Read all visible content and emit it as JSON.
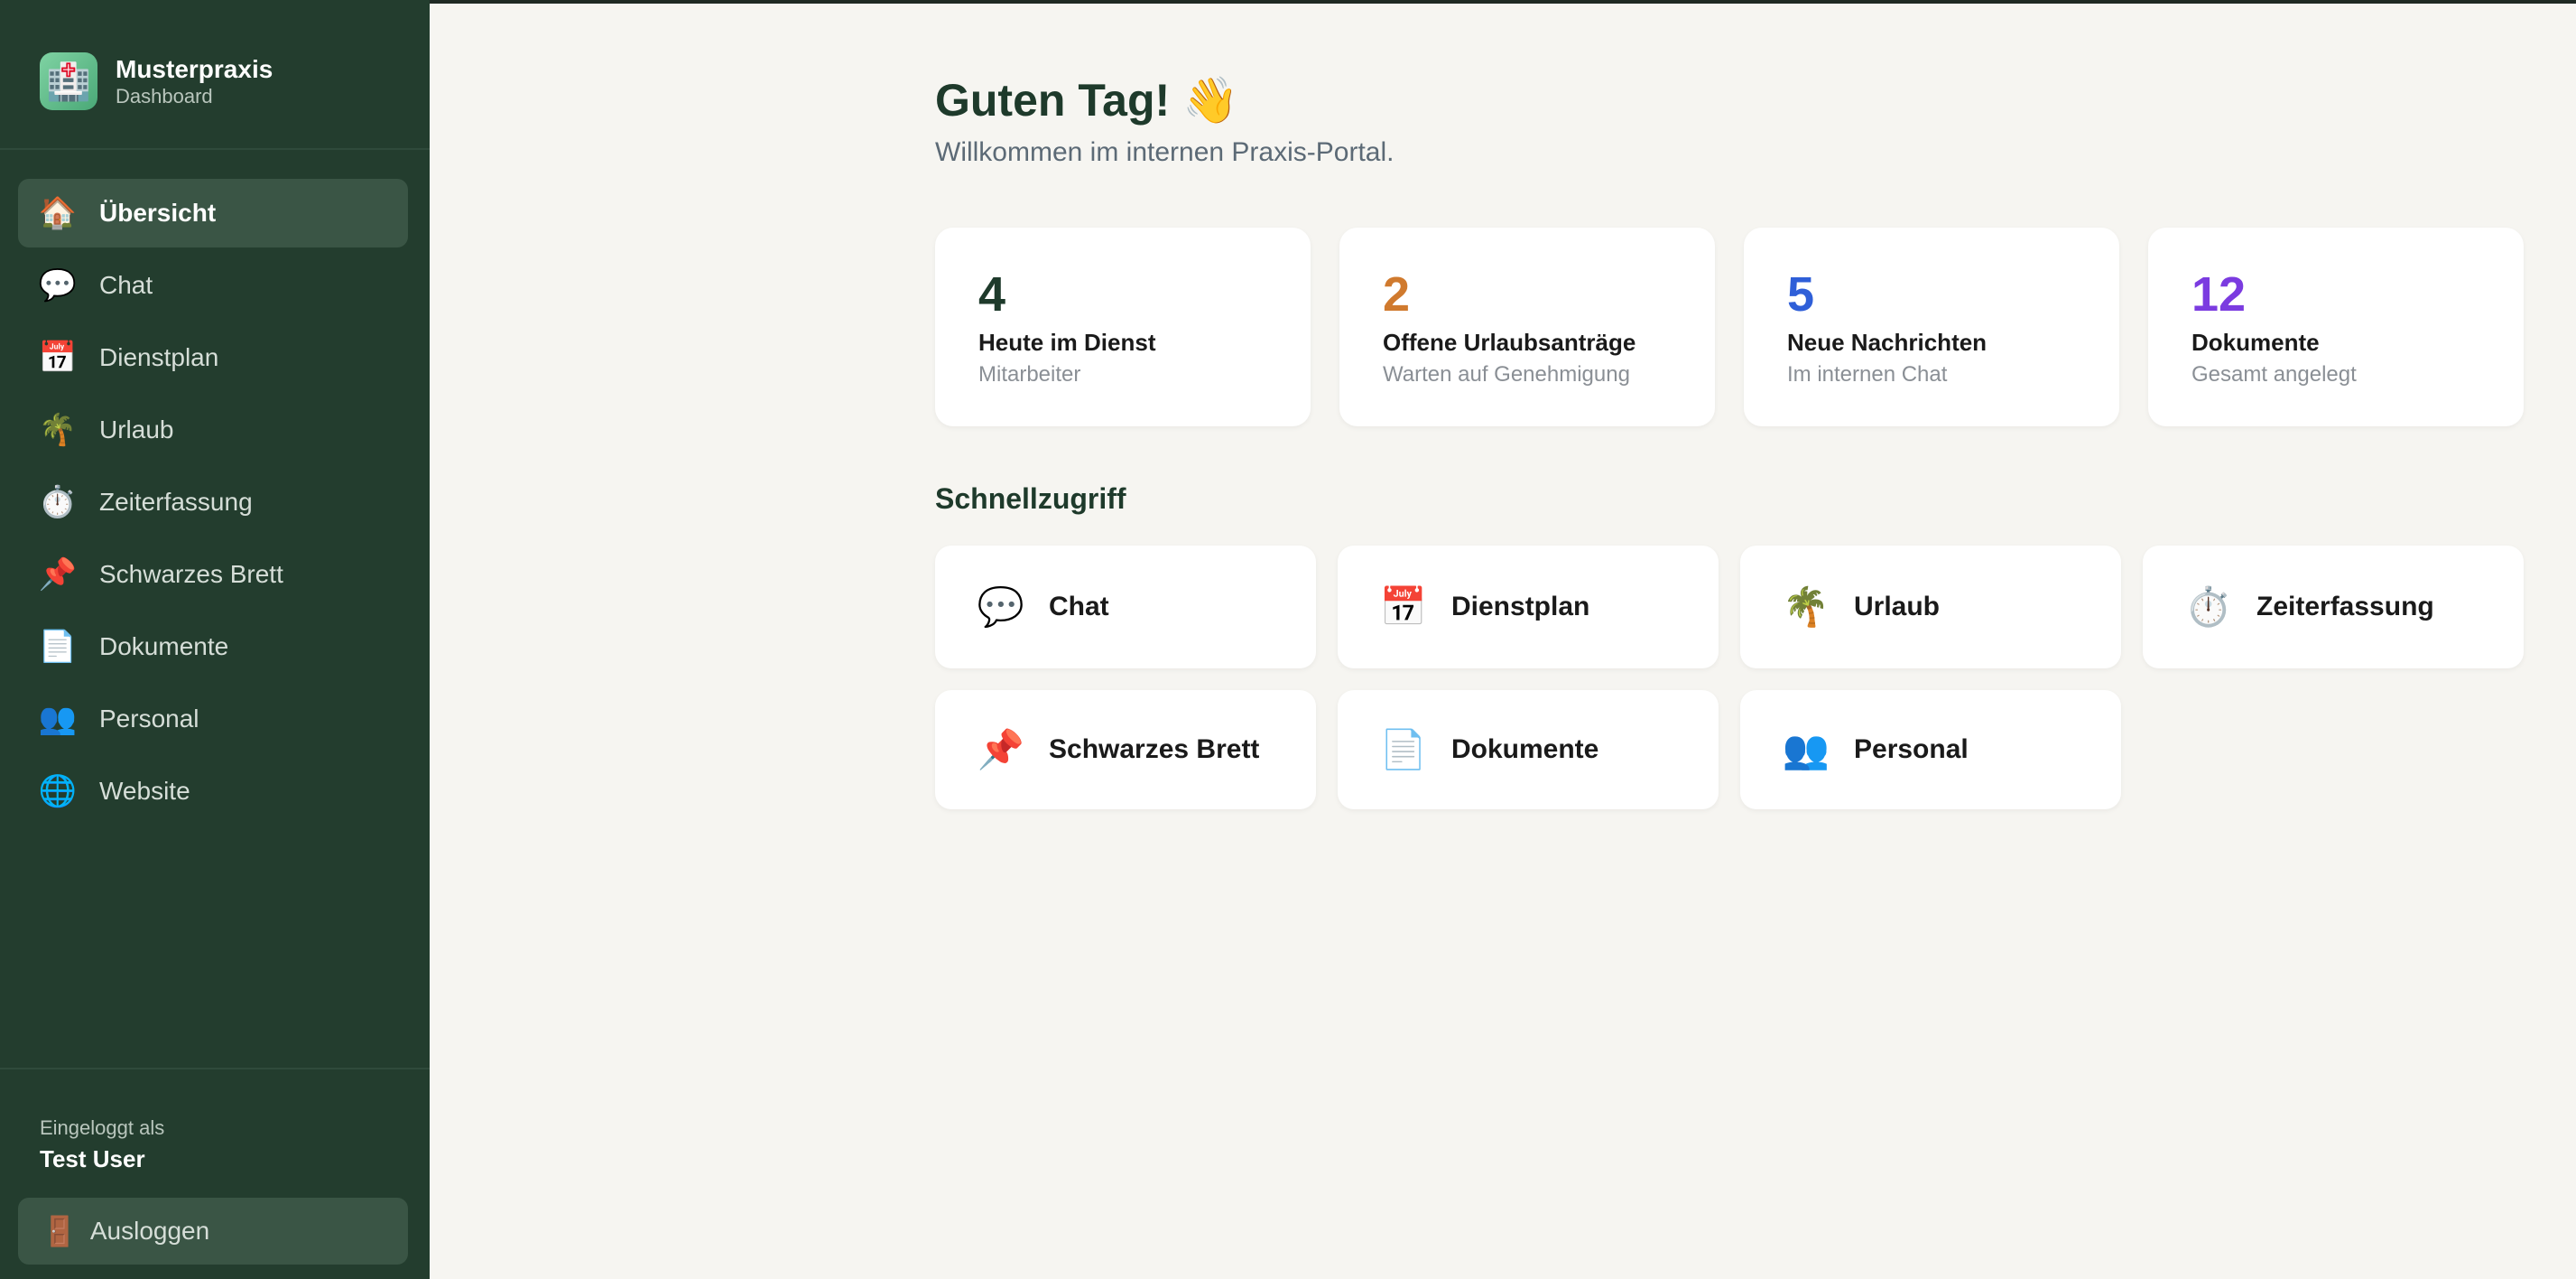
{
  "brand": {
    "name": "Musterpraxis",
    "subtitle": "Dashboard",
    "logo_icon": "hospital-icon"
  },
  "sidebar": {
    "items": [
      {
        "label": "Übersicht",
        "icon": "🏠",
        "icon_name": "house-icon",
        "active": true
      },
      {
        "label": "Chat",
        "icon": "💬",
        "icon_name": "speech-bubble-icon"
      },
      {
        "label": "Dienstplan",
        "icon": "📅",
        "icon_name": "calendar-icon"
      },
      {
        "label": "Urlaub",
        "icon": "🌴",
        "icon_name": "palm-tree-icon"
      },
      {
        "label": "Zeiterfassung",
        "icon": "⏱️",
        "icon_name": "stopwatch-icon"
      },
      {
        "label": "Schwarzes Brett",
        "icon": "📌",
        "icon_name": "pushpin-icon"
      },
      {
        "label": "Dokumente",
        "icon": "📄",
        "icon_name": "document-icon"
      },
      {
        "label": "Personal",
        "icon": "👥",
        "icon_name": "people-icon"
      },
      {
        "label": "Website",
        "icon": "🌐",
        "icon_name": "globe-icon"
      }
    ],
    "logged_in_label": "Eingeloggt als",
    "user_name": "Test User",
    "logout_label": "Ausloggen",
    "logout_icon": "🚪"
  },
  "main": {
    "greeting": "Guten Tag! 👋",
    "subtitle": "Willkommen im internen Praxis-Portal.",
    "stats": [
      {
        "value": "4",
        "title": "Heute im Dienst",
        "subtitle": "Mitarbeiter",
        "color": "#1e3a2b"
      },
      {
        "value": "2",
        "title": "Offene Urlaubsanträge",
        "subtitle": "Warten auf Genehmigung",
        "color": "#d07a2e"
      },
      {
        "value": "5",
        "title": "Neue Nachrichten",
        "subtitle": "Im internen Chat",
        "color": "#2f5fd8"
      },
      {
        "value": "12",
        "title": "Dokumente",
        "subtitle": "Gesamt angelegt",
        "color": "#7b3be0"
      }
    ],
    "quick_access_title": "Schnellzugriff",
    "quick_access": [
      {
        "label": "Chat",
        "icon": "💬"
      },
      {
        "label": "Dienstplan",
        "icon": "📅"
      },
      {
        "label": "Urlaub",
        "icon": "🌴"
      },
      {
        "label": "Zeiterfassung",
        "icon": "⏱️"
      },
      {
        "label": "Schwarzes Brett",
        "icon": "📌"
      },
      {
        "label": "Dokumente",
        "icon": "📄"
      },
      {
        "label": "Personal",
        "icon": "👥"
      }
    ]
  }
}
